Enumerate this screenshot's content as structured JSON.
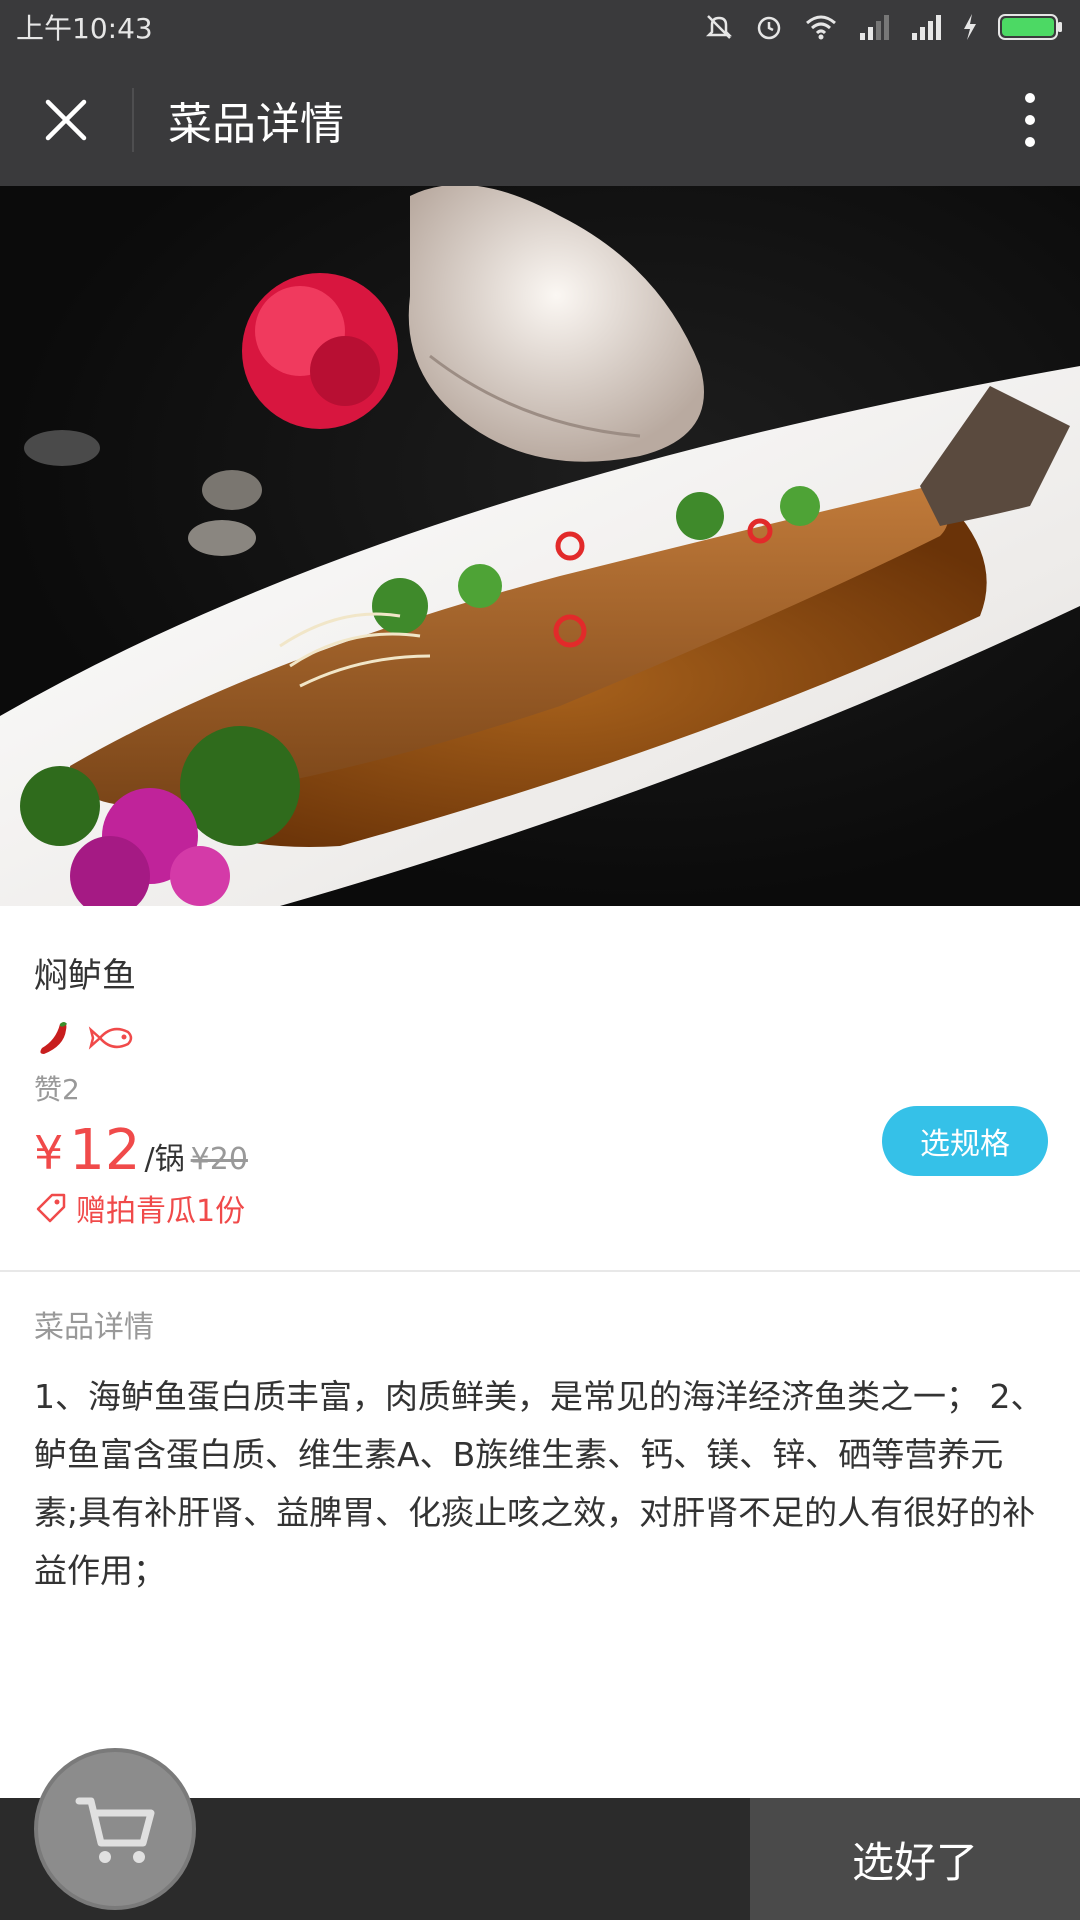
{
  "status_bar": {
    "time": "上午10:43",
    "icons": [
      "bell-off-icon",
      "alarm-icon",
      "wifi-icon",
      "signal-icon",
      "signal-icon",
      "charging-icon",
      "battery-icon"
    ],
    "battery_color": "#4cd964"
  },
  "header": {
    "title": "菜品详情",
    "close_icon": "close-icon",
    "more_icon": "more-vertical-icon"
  },
  "dish": {
    "name": "焖鲈鱼",
    "tags": [
      "chili-icon",
      "fish-icon"
    ],
    "likes": "赞2",
    "currency": "¥",
    "price": "12",
    "unit": "/锅",
    "original_price": "¥20",
    "promo": "赠拍青瓜1份",
    "spec_button": "选规格"
  },
  "detail": {
    "section_title": "菜品详情",
    "body": "1、海鲈鱼蛋白质丰富，肉质鲜美，是常见的海洋经济鱼类之一； 2、鲈鱼富含蛋白质、维生素A、B族维生素、钙、镁、锌、硒等营养元素;具有补肝肾、益脾胃、化痰止咳之效，对肝肾不足的人有很好的补益作用；"
  },
  "footer": {
    "done_button": "选好了",
    "cart_icon": "cart-icon"
  },
  "colors": {
    "accent": "#35c1e8",
    "price": "#f04a4a",
    "header_bg": "#3a3a3c"
  }
}
